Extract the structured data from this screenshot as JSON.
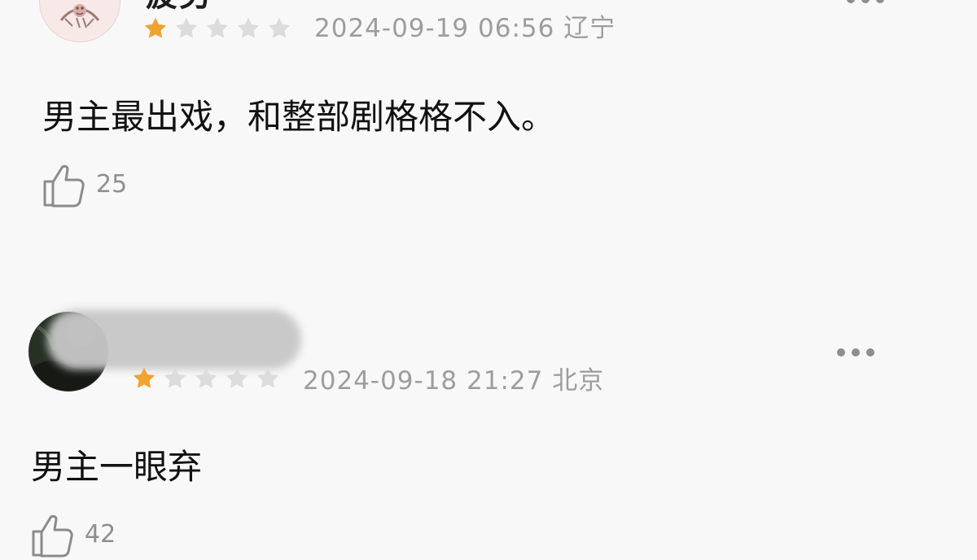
{
  "reviews": [
    {
      "username_partial": "疲劳",
      "rating": 1,
      "max_rating": 5,
      "datetime": "2024-09-19 06:56",
      "location": "辽宁",
      "content": "男主最出戏，和整部剧格格不入。",
      "likes": "25"
    },
    {
      "rating": 1,
      "max_rating": 5,
      "datetime": "2024-09-18 21:27",
      "location": "北京",
      "content": "男主一眼弃",
      "likes": "42"
    }
  ],
  "icons": {
    "star_filled": "star-filled-icon",
    "star_empty": "star-empty-icon",
    "thumb": "thumbs-up-icon",
    "more": "more-icon",
    "avatar": "avatar"
  },
  "colors": {
    "background": "#f8f8f8",
    "star_filled": "#f0a32e",
    "star_empty": "#dcdcdc",
    "meta_text": "#9d9d9d",
    "main_text": "#111111",
    "more_dots": "#8e8e8e"
  }
}
